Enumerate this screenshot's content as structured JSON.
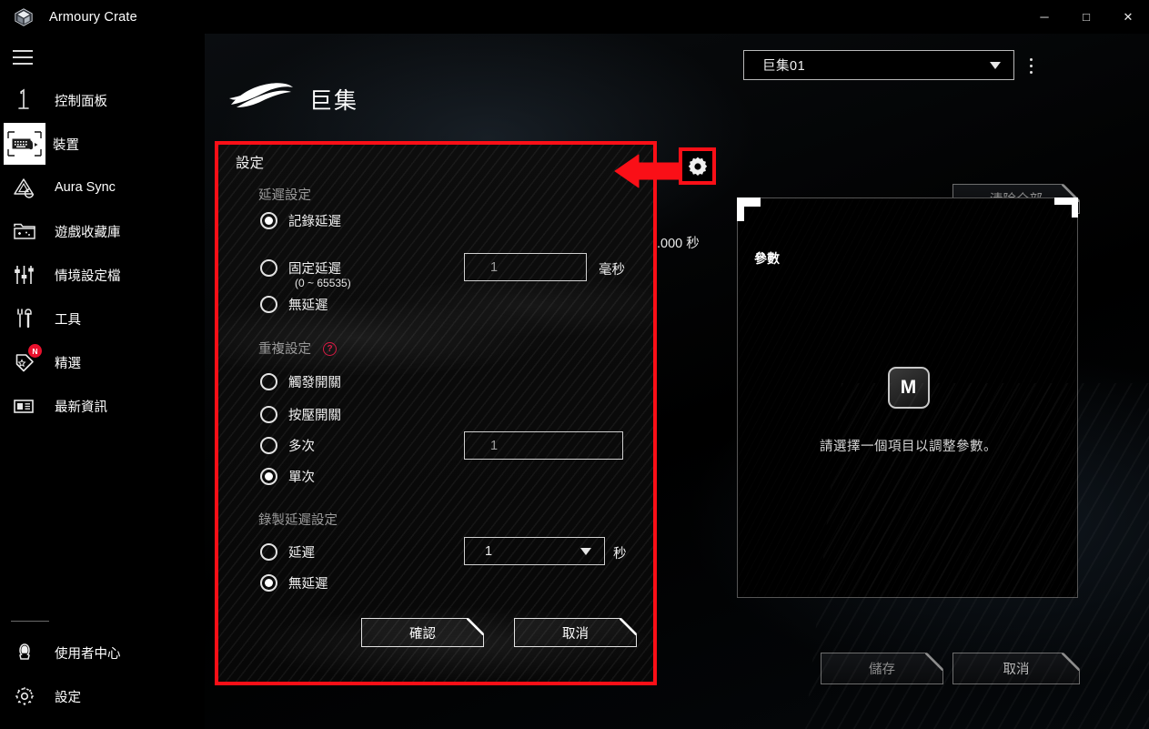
{
  "window": {
    "title": "Armoury Crate",
    "logo_icon": "armoury-crate-logo",
    "minimize_icon": "─",
    "maximize_icon": "□",
    "close_icon": "✕"
  },
  "sidebar": {
    "menu_icon": "hamburger-icon",
    "items": [
      {
        "label": "控制面板",
        "icon": "dashboard-icon",
        "active": false,
        "badge": ""
      },
      {
        "label": "裝置",
        "icon": "device-icon",
        "active": true,
        "badge": ""
      },
      {
        "label": "Aura Sync",
        "icon": "aura-sync-icon",
        "active": false,
        "badge": ""
      },
      {
        "label": "遊戲收藏庫",
        "icon": "game-library-icon",
        "active": false,
        "badge": ""
      },
      {
        "label": "情境設定檔",
        "icon": "scenario-profile-icon",
        "active": false,
        "badge": ""
      },
      {
        "label": "工具",
        "icon": "tools-icon",
        "active": false,
        "badge": ""
      },
      {
        "label": "精選",
        "icon": "featured-icon",
        "active": false,
        "badge": "N"
      },
      {
        "label": "最新資訊",
        "icon": "news-icon",
        "active": false,
        "badge": ""
      }
    ],
    "bottom_items": [
      {
        "label": "使用者中心",
        "icon": "user-center-icon"
      },
      {
        "label": "設定",
        "icon": "settings-gear-icon"
      }
    ]
  },
  "header": {
    "rog_logo_icon": "rog-logo",
    "page_title": "巨集",
    "profile_value": "巨集01",
    "profile_caret_icon": "chevron-down-icon",
    "kebab_icon": "more-vertical-icon"
  },
  "main": {
    "clear_all_label": "清除全部",
    "partial_seconds_text": ".000 秒",
    "gear_icon": "settings-gear-icon"
  },
  "param_panel": {
    "title": "參數",
    "macro_key_glyph": "M",
    "empty_text": "請選擇一個項目以調整參數。",
    "save_label": "儲存",
    "cancel_label": "取消"
  },
  "dialog": {
    "title": "設定",
    "delay_group": {
      "label": "延遲設定",
      "options": [
        {
          "label": "記錄延遲",
          "checked": true,
          "sub": ""
        },
        {
          "label": "固定延遲",
          "checked": false,
          "sub": "(0 ~ 65535)"
        },
        {
          "label": "無延遲",
          "checked": false,
          "sub": ""
        }
      ],
      "input_value": "1",
      "unit": "毫秒"
    },
    "repeat_group": {
      "label": "重複設定",
      "help_icon": "help-question-icon",
      "help_glyph": "?",
      "options": [
        {
          "label": "觸發開關",
          "checked": false
        },
        {
          "label": "按壓開關",
          "checked": false
        },
        {
          "label": "多次",
          "checked": false
        },
        {
          "label": "單次",
          "checked": true
        }
      ],
      "input_value": "1"
    },
    "record_delay_group": {
      "label": "錄製延遲設定",
      "options": [
        {
          "label": "延遲",
          "checked": false
        },
        {
          "label": "無延遲",
          "checked": true
        }
      ],
      "select_value": "1",
      "select_caret_icon": "chevron-down-icon",
      "unit": "秒"
    },
    "confirm_label": "確認",
    "cancel_label": "取消"
  },
  "annotation": {
    "arrow_icon": "red-left-arrow-annotation",
    "highlight_color": "#fa0f17"
  }
}
